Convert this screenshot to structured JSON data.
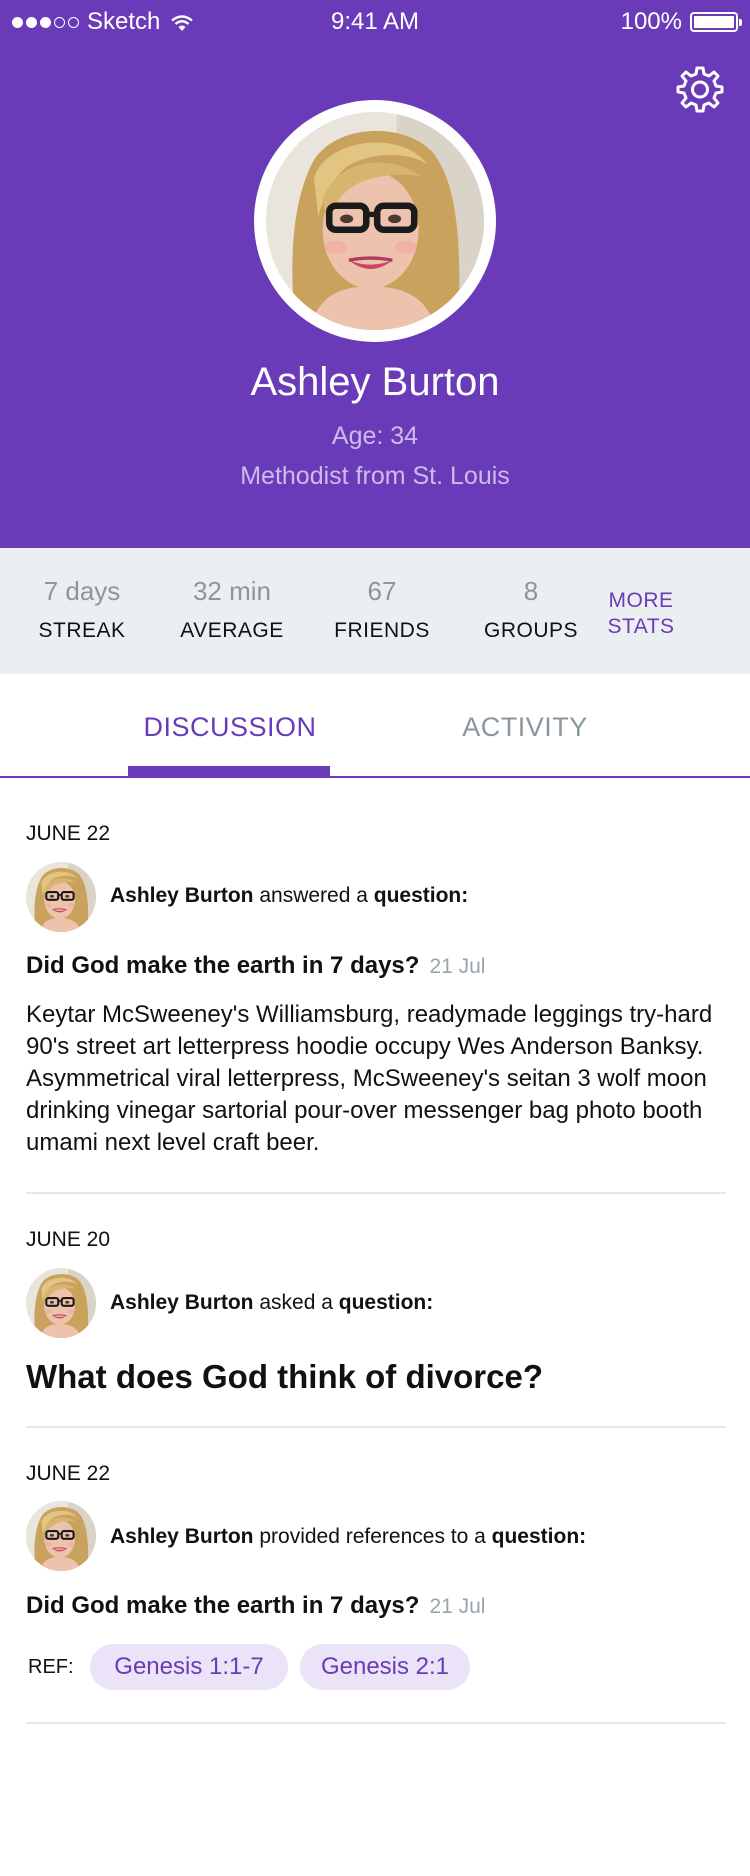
{
  "status_bar": {
    "carrier": "Sketch",
    "time": "9:41 AM",
    "battery": "100%"
  },
  "profile": {
    "name": "Ashley Burton",
    "age": "Age: 34",
    "location": "Methodist from St. Louis"
  },
  "stats": {
    "items": [
      {
        "value": "7 days",
        "label": "STREAK"
      },
      {
        "value": "32 min",
        "label": "AVERAGE"
      },
      {
        "value": "67",
        "label": "FRIENDS"
      },
      {
        "value": "8",
        "label": "GROUPS"
      }
    ],
    "more_line1": "MORE",
    "more_line2": "STATS"
  },
  "tabs": {
    "discussion": "DISCUSSION",
    "activity": "ACTIVITY",
    "active": "discussion"
  },
  "feed": [
    {
      "date": "JUNE 22",
      "user": "Ashley Burton",
      "action": " answered a ",
      "object": "question:",
      "question": "Did God make the earth in 7 days?",
      "question_date": "21 Jul",
      "body": "Keytar McSweeney's Williamsburg, readymade leggings try-hard 90's street art letterpress hoodie occupy Wes Anderson Banksy. Asymmetrical viral letterpress, McSweeney's seitan 3 wolf moon drinking vinegar sartorial pour-over messenger bag photo booth umami next level craft beer."
    },
    {
      "date": "JUNE 20",
      "user": "Ashley Burton",
      "action": " asked a ",
      "object": "question:",
      "question": "What does God think of divorce?"
    },
    {
      "date": "JUNE 22",
      "user": "Ashley Burton",
      "action": " provided references to a ",
      "object": "question:",
      "question": "Did God make the earth in 7 days?",
      "question_date": "21 Jul",
      "ref_label": "REF:",
      "refs": [
        "Genesis 1:1-7",
        "Genesis 2:1"
      ]
    }
  ],
  "colors": {
    "primary": "#6a3bb9",
    "stats_bg": "#eceff1",
    "muted": "#8a979e",
    "chip_bg": "#ebe3f7"
  },
  "icons": {
    "settings": "gear-icon",
    "wifi": "wifi-icon",
    "battery": "battery-icon"
  }
}
